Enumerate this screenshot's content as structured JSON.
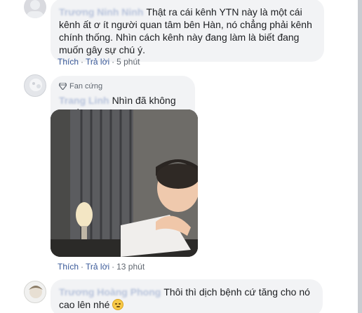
{
  "comments": [
    {
      "author": "Trương Ninh Ninh",
      "text": "Thật ra cái kênh YTN này là một cái kênh ất ơ ít người quan tâm bên Hàn, nó chẳng phải kênh chính thống. Nhìn cách kênh này đang làm là biết đang muốn gây sự chú ý.",
      "like": "Thích",
      "reply": "Trả lời",
      "time": "5 phút"
    },
    {
      "badge": "Fan cứng",
      "author": "Trang Linh",
      "text": "Nhìn đã không ưa rồi",
      "like": "Thích",
      "reply": "Trả lời",
      "time": "13 phút"
    },
    {
      "author": "Trương Hoàng Phong",
      "text": "Thôi thì dịch bệnh cứ tăng cho nó cao lên nhé"
    }
  ],
  "separator": "·",
  "icons": {
    "badge": "gem-icon",
    "emoji": "smirk-emoji-icon"
  },
  "colors": {
    "bubble": "#f2f3f5",
    "link": "#385898",
    "meta": "#606770"
  }
}
